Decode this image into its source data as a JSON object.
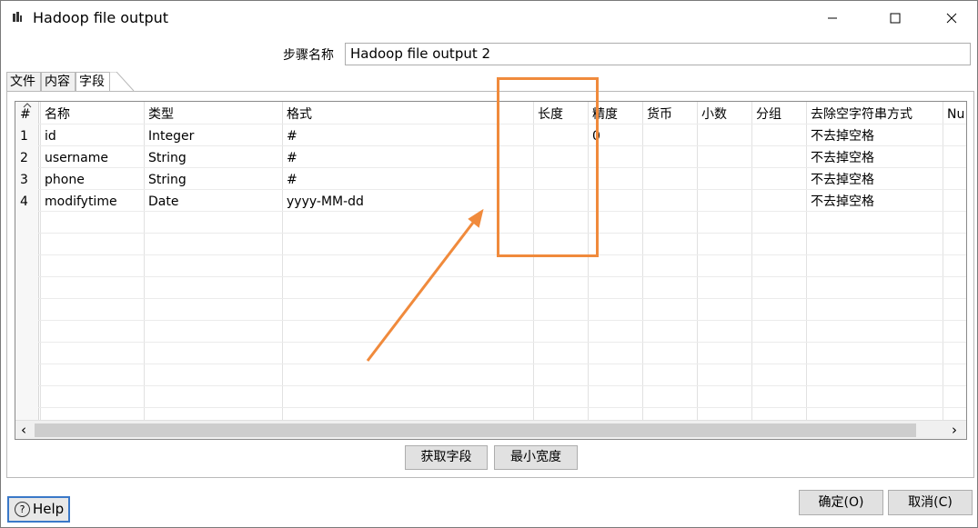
{
  "window": {
    "title": "Hadoop file output",
    "minimize_icon": "minimize-icon",
    "maximize_icon": "maximize-icon",
    "close_icon": "close-icon"
  },
  "step": {
    "label": "步骤名称",
    "value": "Hadoop file output 2"
  },
  "tabs": [
    {
      "label": "文件",
      "active": false
    },
    {
      "label": "内容",
      "active": false
    },
    {
      "label": "字段",
      "active": true
    }
  ],
  "table": {
    "columns": [
      "#",
      "名称",
      "类型",
      "格式",
      "长度",
      "精度",
      "货币",
      "小数",
      "分组",
      "去除空字符串方式",
      "Nu"
    ],
    "rows": [
      [
        "1",
        "id",
        "Integer",
        "#",
        "",
        "0",
        "",
        "",
        "",
        "不去掉空格"
      ],
      [
        "2",
        "username",
        "String",
        "#",
        "",
        "",
        "",
        "",
        "",
        "不去掉空格"
      ],
      [
        "3",
        "phone",
        "String",
        "#",
        "",
        "",
        "",
        "",
        "",
        "不去掉空格"
      ],
      [
        "4",
        "modifytime",
        "Date",
        "yyyy-MM-dd",
        "",
        "",
        "",
        "",
        "",
        "不去掉空格"
      ]
    ]
  },
  "scroll": {
    "left_icon": "‹",
    "right_icon": "›"
  },
  "buttons": {
    "get_fields": "获取字段",
    "min_width": "最小宽度",
    "help": "Help",
    "ok": "确定(O)",
    "cancel": "取消(C)"
  },
  "colors": {
    "annotation": "#f08a3c",
    "help_border": "#3a78c8"
  }
}
